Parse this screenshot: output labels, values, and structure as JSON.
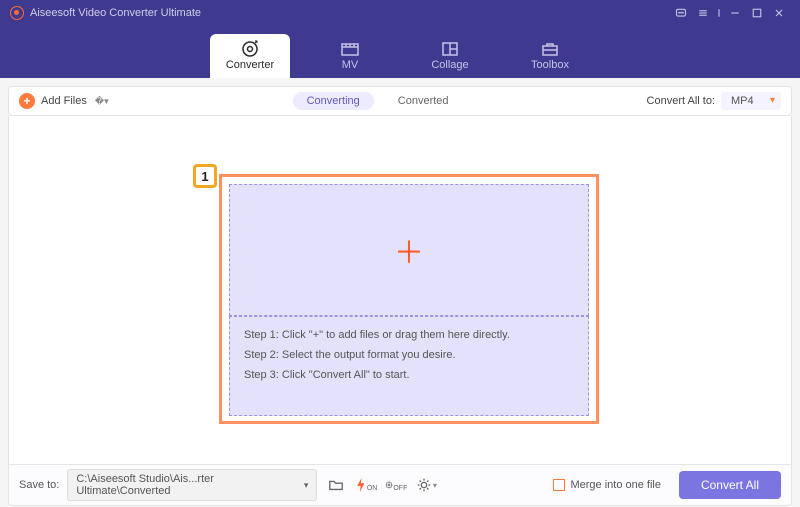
{
  "titlebar": {
    "title": "Aiseesoft Video Converter Ultimate"
  },
  "tabs": {
    "converter": "Converter",
    "mv": "MV",
    "collage": "Collage",
    "toolbox": "Toolbox"
  },
  "toolbar": {
    "add_files": "Add Files",
    "converting": "Converting",
    "converted": "Converted",
    "convert_all_to": "Convert All to:",
    "format": "MP4"
  },
  "highlight": {
    "badge": "1"
  },
  "steps": {
    "s1": "Step 1: Click \"+\" to add files or drag them here directly.",
    "s2": "Step 2: Select the output format you desire.",
    "s3": "Step 3: Click \"Convert All\" to start."
  },
  "footer": {
    "save_to": "Save to:",
    "path": "C:\\Aiseesoft Studio\\Ais...rter Ultimate\\Converted",
    "gpu_on": "ON",
    "gpu_off": "OFF",
    "merge": "Merge into one file",
    "convert_all": "Convert All"
  }
}
